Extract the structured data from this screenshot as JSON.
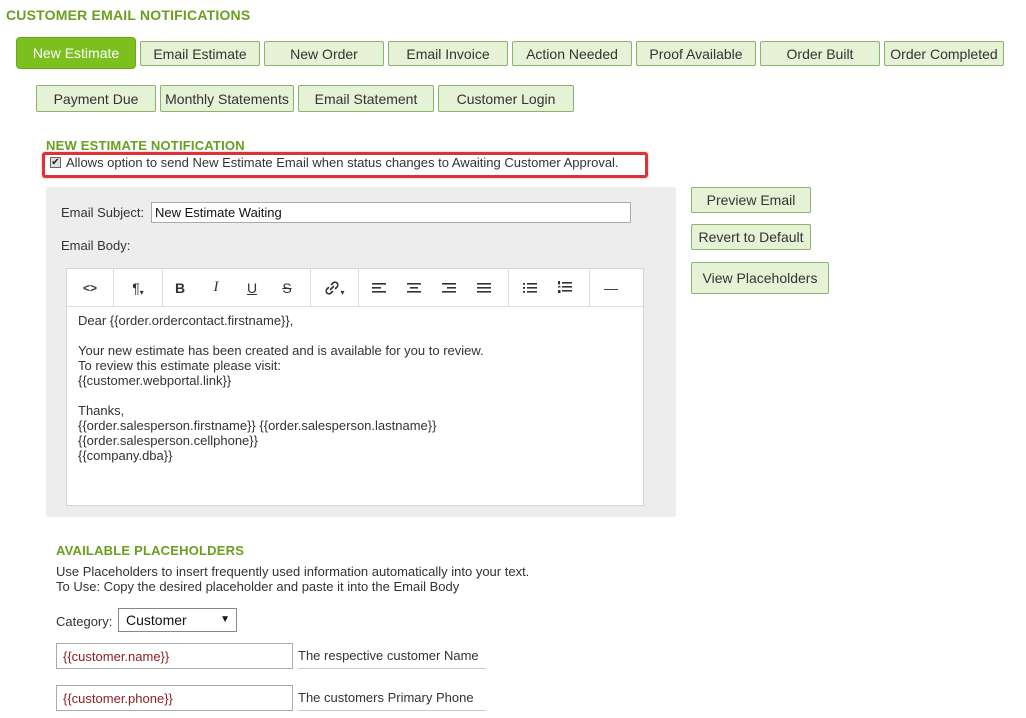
{
  "page": {
    "title": "CUSTOMER EMAIL NOTIFICATIONS"
  },
  "tabs": {
    "row1": [
      "New Estimate",
      "Email Estimate",
      "New Order",
      "Email Invoice",
      "Action Needed",
      "Proof Available",
      "Order Built",
      "Order Completed"
    ],
    "row2": [
      "Payment Due",
      "Monthly Statements",
      "Email Statement",
      "Customer Login"
    ],
    "active": "New Estimate"
  },
  "notification": {
    "title": "NEW ESTIMATE NOTIFICATION",
    "checkbox_label": "Allows option to send New Estimate Email when status changes to Awaiting Customer Approval.",
    "checked": true
  },
  "form": {
    "subject_label": "Email Subject:",
    "subject_value": "New Estimate Waiting",
    "body_label": "Email Body:",
    "body_lines": [
      "Dear {{order.ordercontact.firstname}},",
      "",
      "Your new estimate has been created and is available for you to review.",
      "To review this estimate please visit:",
      "{{customer.webportal.link}}",
      "",
      "Thanks,",
      "{{order.salesperson.firstname}} {{order.salesperson.lastname}}",
      "{{order.salesperson.cellphone}}",
      "{{company.dba}}"
    ]
  },
  "toolbar": {
    "code": "<>",
    "paragraph": "¶",
    "bold": "B",
    "italic": "I",
    "underline": "U",
    "strike": "S",
    "link": "🔗",
    "hr": "—"
  },
  "side_buttons": {
    "preview": "Preview Email",
    "revert": "Revert to Default",
    "placeholders": "View Placeholders"
  },
  "placeholders": {
    "title": "AVAILABLE PLACEHOLDERS",
    "desc_line1": "Use Placeholders to insert frequently used information automatically into your text.",
    "desc_line2": "To Use: Copy the desired placeholder and paste it into the Email Body",
    "category_label": "Category:",
    "category_value": "Customer",
    "items": [
      {
        "code": "{{customer.name}}",
        "description": "The respective customer Name"
      },
      {
        "code": "{{customer.phone}}",
        "description": "The customers Primary Phone"
      }
    ]
  }
}
